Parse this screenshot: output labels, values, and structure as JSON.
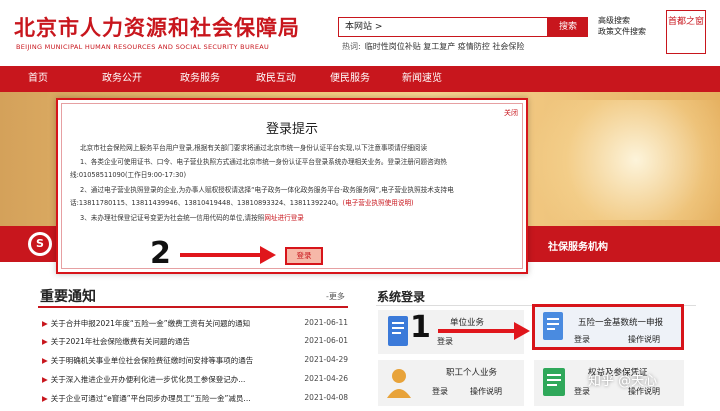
{
  "header": {
    "title": "北京市人力资源和社会保障局",
    "subtitle": "BEIJING MUNICIPAL HUMAN RESOURCES AND SOCIAL SECURITY BUREAU",
    "search_value": "本网站 >",
    "search_button": "搜索",
    "advanced_search": "高级搜索",
    "policy_search": "政策文件搜索",
    "hot_label": "热词:",
    "hot_words": "临时性岗位补贴 复工复产 疫情防控 社会保险",
    "seal_text": "首都之窗",
    "colors": {
      "brand_red": "#c8161d"
    }
  },
  "nav": {
    "items": [
      {
        "label": "首页"
      },
      {
        "label": "政务公开"
      },
      {
        "label": "政务服务"
      },
      {
        "label": "政民互动"
      },
      {
        "label": "便民服务"
      },
      {
        "label": "新闻速览"
      }
    ]
  },
  "service_bar": {
    "logo_glyph": "S",
    "right_item": "社保服务机构"
  },
  "notices": {
    "title": "重要通知",
    "more": "-更多",
    "items": [
      {
        "text": "关于合并申报2021年度“五险一金”缴费工资有关问题的通知",
        "date": "2021-06-11"
      },
      {
        "text": "关于2021年社会保险缴费有关问题的通告",
        "date": "2021-06-01"
      },
      {
        "text": "关于明确机关事业单位社会保险费征缴时间安排等事项的通告",
        "date": "2021-04-29"
      },
      {
        "text": "关于深入推进企业开办便利化进一步优化员工参保登记办...",
        "date": "2021-04-26"
      },
      {
        "text": "关于企业可通过“e窗通”平台同步办理员工“五险一金”减员...",
        "date": "2021-04-08"
      }
    ]
  },
  "system_login": {
    "title": "系统登录",
    "cards": [
      {
        "title": "单位业务",
        "login": "登录",
        "help": ""
      },
      {
        "title": "五险一金基数统一申报",
        "login": "登录",
        "help": "操作说明"
      },
      {
        "title": "职工个人业务",
        "login": "登录",
        "help": "操作说明"
      },
      {
        "title": "权益及参保凭证",
        "login": "登录",
        "help": "操作说明"
      }
    ]
  },
  "modal": {
    "title": "登录提示",
    "close": "关闭",
    "intro": "北京市社会保险网上服务平台用户登录,根据有关部门要求将通过北京市统一身份认证平台实现,以下注意事项请仔细阅读",
    "p1a": "1、各类企业可使用证书、口令、电子营业执照方式通过北京市统一身份认证平台登录系统办理相关业务。登录注册问题咨询热",
    "p1b": "线:01058511090(工作日9:00-17:30)",
    "p2a": "2、通过电子营业执照登录的企业,为办事人赋权授权请选择“电子政务一体化政务服务平台-政务服务网”,电子营业执照技术支持电",
    "p2b": "话:13811780115、13811439946、13810419448、13810893324、13811392240。",
    "p2link": "(电子营业执照使用说明)",
    "p3": "3、未办理社保登记证号变更为社会统一信用代码的单位,请按照",
    "p3link": "网址进行登录",
    "login_button": "登录"
  },
  "annotations": {
    "step1": "1",
    "step2": "2",
    "arrow_color": "#e0161c"
  },
  "watermark": "知乎 @天心"
}
